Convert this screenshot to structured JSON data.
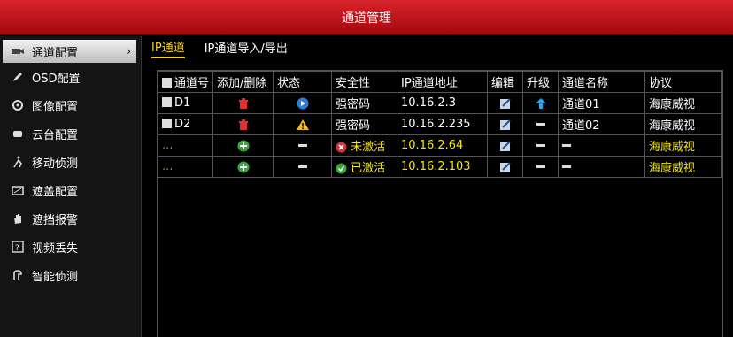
{
  "title": "通道管理",
  "sidebar": {
    "items": [
      {
        "label": "通道配置",
        "icon": "camera-icon",
        "active": true
      },
      {
        "label": "OSD配置",
        "icon": "pen-icon"
      },
      {
        "label": "图像配置",
        "icon": "image-icon"
      },
      {
        "label": "云台配置",
        "icon": "ptz-icon"
      },
      {
        "label": "移动侦测",
        "icon": "running-man-icon"
      },
      {
        "label": "遮盖配置",
        "icon": "mask-icon"
      },
      {
        "label": "遮挡报警",
        "icon": "hand-icon"
      },
      {
        "label": "视频丢失",
        "icon": "question-icon"
      },
      {
        "label": "智能侦测",
        "icon": "smart-detect-icon"
      }
    ],
    "arrow": "›"
  },
  "tabs": [
    {
      "label": "IP通道",
      "active": true
    },
    {
      "label": "IP通道导入/导出"
    }
  ],
  "table": {
    "headers": [
      "通道号",
      "添加/删除",
      "状态",
      "安全性",
      "IP通道地址",
      "编辑",
      "升级",
      "通道名称",
      "协议"
    ],
    "rows": [
      {
        "channel": "D1",
        "action": "delete-icon",
        "status": "play-icon",
        "security": "强密码",
        "ip": "10.16.2.3",
        "upgrade": "upgrade-arrow-icon",
        "name": "通道01",
        "protocol": "海康威视",
        "highlight": false
      },
      {
        "channel": "D2",
        "action": "delete-icon",
        "status": "warning-icon",
        "security": "强密码",
        "ip": "10.16.2.235",
        "upgrade": "dash",
        "name": "通道02",
        "protocol": "海康威视",
        "highlight": false
      },
      {
        "channel": "...",
        "action": "add-icon",
        "status": "dash",
        "security": "未激活",
        "security_icon": "inactive-icon",
        "ip": "10.16.2.64",
        "upgrade": "dash",
        "name": "-",
        "protocol": "海康威视",
        "highlight": true
      },
      {
        "channel": "...",
        "action": "add-icon",
        "status": "dash",
        "security": "已激活",
        "security_icon": "active-icon",
        "ip": "10.16.2.103",
        "upgrade": "dash",
        "name": "-",
        "protocol": "海康威视",
        "highlight": true
      }
    ]
  },
  "colors": {
    "title_red": "#c4161c",
    "highlight_yellow": "#f3e51b",
    "tab_yellow": "#f3d12a"
  }
}
